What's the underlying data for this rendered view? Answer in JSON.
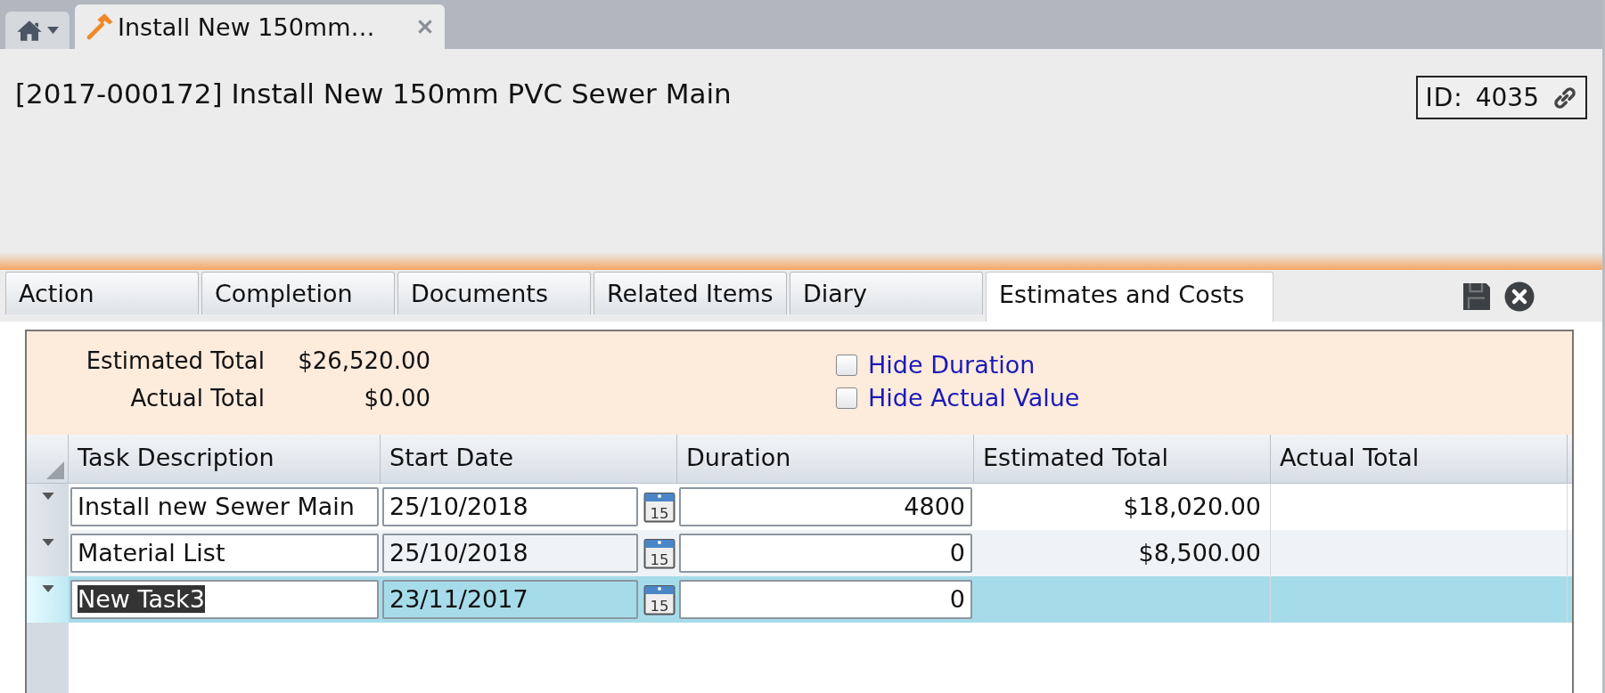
{
  "doc_tabs": [
    {
      "kind": "home",
      "selected": false
    },
    {
      "kind": "document",
      "title": "Install New 150mm…",
      "selected": true
    }
  ],
  "record": {
    "title": "[2017-000172] Install New 150mm PVC Sewer Main",
    "id_label": "ID:",
    "id_value": "4035"
  },
  "tabs": [
    {
      "label": "Action",
      "selected": false
    },
    {
      "label": "Completion",
      "selected": false
    },
    {
      "label": "Documents",
      "selected": false
    },
    {
      "label": "Related Items",
      "selected": false
    },
    {
      "label": "Diary",
      "selected": false
    },
    {
      "label": "Estimates and Costs",
      "selected": true
    }
  ],
  "summary": {
    "totals": [
      {
        "label": "Estimated Total",
        "value": "$26,520.00"
      },
      {
        "label": "Actual Total",
        "value": "$0.00"
      }
    ],
    "options": [
      {
        "label": "Hide Duration",
        "checked": false
      },
      {
        "label": "Hide Actual Value",
        "checked": false
      }
    ]
  },
  "table": {
    "columns": [
      "Task Description",
      "Start Date",
      "Duration",
      "Estimated Total",
      "Actual Total"
    ],
    "rows": [
      {
        "description": "Install new Sewer Main",
        "start_date": "25/10/2018",
        "duration": "4800",
        "calendar_icon_text": "15",
        "estimated_total": "$18,020.00",
        "selected": false
      },
      {
        "description": "Material List",
        "start_date": "25/10/2018",
        "duration": "0",
        "calendar_icon_text": "15",
        "estimated_total": "$8,500.00",
        "selected": false
      },
      {
        "description": "New Task3",
        "start_date": "23/11/2017",
        "duration": "0",
        "calendar_icon_text": "15",
        "selected": true
      }
    ]
  }
}
